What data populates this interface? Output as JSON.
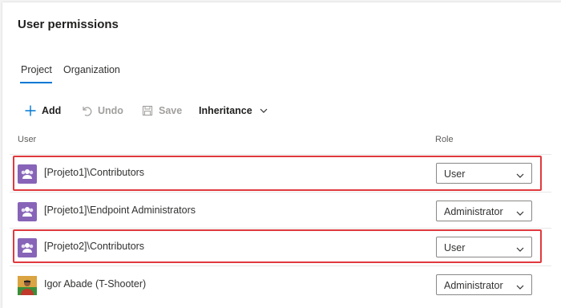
{
  "page": {
    "title": "User permissions"
  },
  "tabs": [
    {
      "label": "Project",
      "selected": true
    },
    {
      "label": "Organization",
      "selected": false
    }
  ],
  "toolbar": {
    "add_label": "Add",
    "undo_label": "Undo",
    "save_label": "Save",
    "inheritance_label": "Inheritance"
  },
  "columns": {
    "user": "User",
    "role": "Role"
  },
  "rows": [
    {
      "name": "[Projeto1]\\Contributors",
      "role": "User",
      "avatar": "group-icon",
      "highlighted": true
    },
    {
      "name": "[Projeto1]\\Endpoint Administrators",
      "role": "Administrator",
      "avatar": "group-icon",
      "highlighted": false
    },
    {
      "name": "[Projeto2]\\Contributors",
      "role": "User",
      "avatar": "group-icon",
      "highlighted": true
    },
    {
      "name": "Igor Abade (T-Shooter)",
      "role": "Administrator",
      "avatar": "user-photo",
      "highlighted": false
    }
  ],
  "colors": {
    "accent": "#0078d4",
    "highlight": "#e0393e",
    "group_avatar": "#8764b8"
  }
}
